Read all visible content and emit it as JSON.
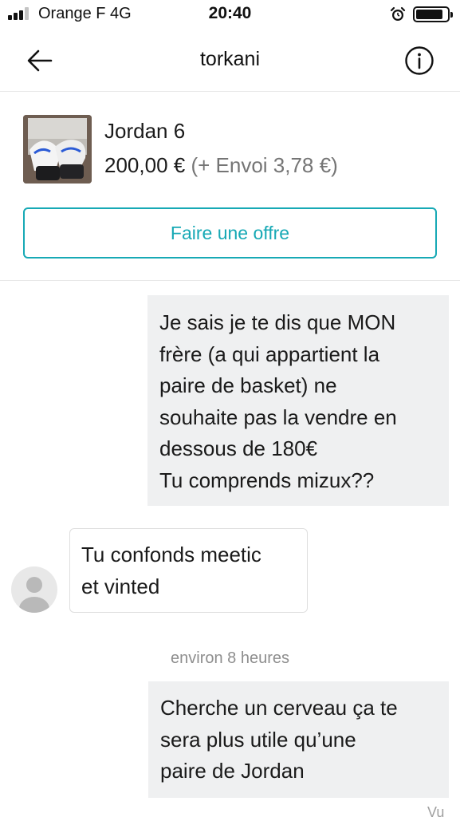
{
  "status_bar": {
    "carrier": "Orange F   4G",
    "time": "20:40",
    "signal_bars_active": 3,
    "signal_bars_total": 4,
    "battery_level": 0.8
  },
  "header": {
    "title": "torkani",
    "back_icon": "arrow-left-icon",
    "info_icon": "info-circle-icon"
  },
  "item": {
    "title": "Jordan 6",
    "price": "200,00 €",
    "shipping": "(+ Envoi 3,78 €)",
    "offer_button_label": "Faire une offre"
  },
  "messages": [
    {
      "direction": "outgoing",
      "text": "Je sais je te dis que MON\nfrère (a qui appartient la\npaire de basket) ne\nsouhaite pas la vendre en\ndessous de 180€\nTu comprends mizux??"
    },
    {
      "direction": "incoming",
      "text": "Tu confonds meetic\net vinted"
    },
    {
      "direction": "outgoing",
      "text": "Cherche un cerveau ça te\nsera plus utile qu’une\npaire de Jordan"
    }
  ],
  "timestamp": "environ 8 heures",
  "read_status": "Vu",
  "colors": {
    "accent": "#17a9b5",
    "outgoing_bubble": "#eff0f1",
    "muted_text": "#757575"
  }
}
